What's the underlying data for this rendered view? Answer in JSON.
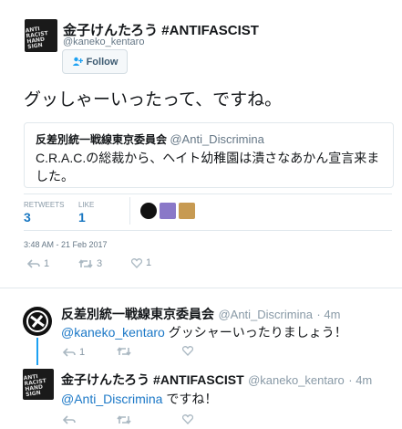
{
  "main_tweet": {
    "avatar_text": "ANTI RACIST HAND SIGN",
    "name": "金子けんたろう #ANTIFASCIST",
    "handle": "@kaneko_kentaro",
    "follow_label": "Follow",
    "text": "グッしゃーいったって、ですね。",
    "quote": {
      "name": "反差別統一戦線東京委員会",
      "handle": "@Anti_Discrimina",
      "text": "C.R.A.C.の総裁から、ヘイト幼稚園は潰さなあかん宣言来ました。"
    },
    "stats": {
      "retweets_label": "RETWEETS",
      "retweets": "3",
      "likes_label": "LIKE",
      "likes": "1"
    },
    "timestamp": "3:48 AM - 21 Feb 2017",
    "actions": {
      "reply_count": "1",
      "retweet_count": "3",
      "like_count": "1"
    }
  },
  "replies": [
    {
      "name": "反差別統一戦線東京委員会",
      "handle": "@Anti_Discrimina",
      "time": "· 4m",
      "mention": "@kaneko_kentaro",
      "text": " グッシャーいったりましょう！",
      "actions": {
        "reply_count": "1",
        "retweet_count": "",
        "like_count": ""
      }
    },
    {
      "name": "金子けんたろう #ANTIFASCIST",
      "handle": "@kaneko_kentaro",
      "time": "· 4m",
      "mention": "@Anti_Discrimina",
      "text": " ですね！",
      "actions": {
        "reply_count": "",
        "retweet_count": "",
        "like_count": ""
      }
    }
  ],
  "colors": {
    "link": "#1b78c7",
    "thread": "#1da1f2",
    "muted": "#8899a6"
  }
}
